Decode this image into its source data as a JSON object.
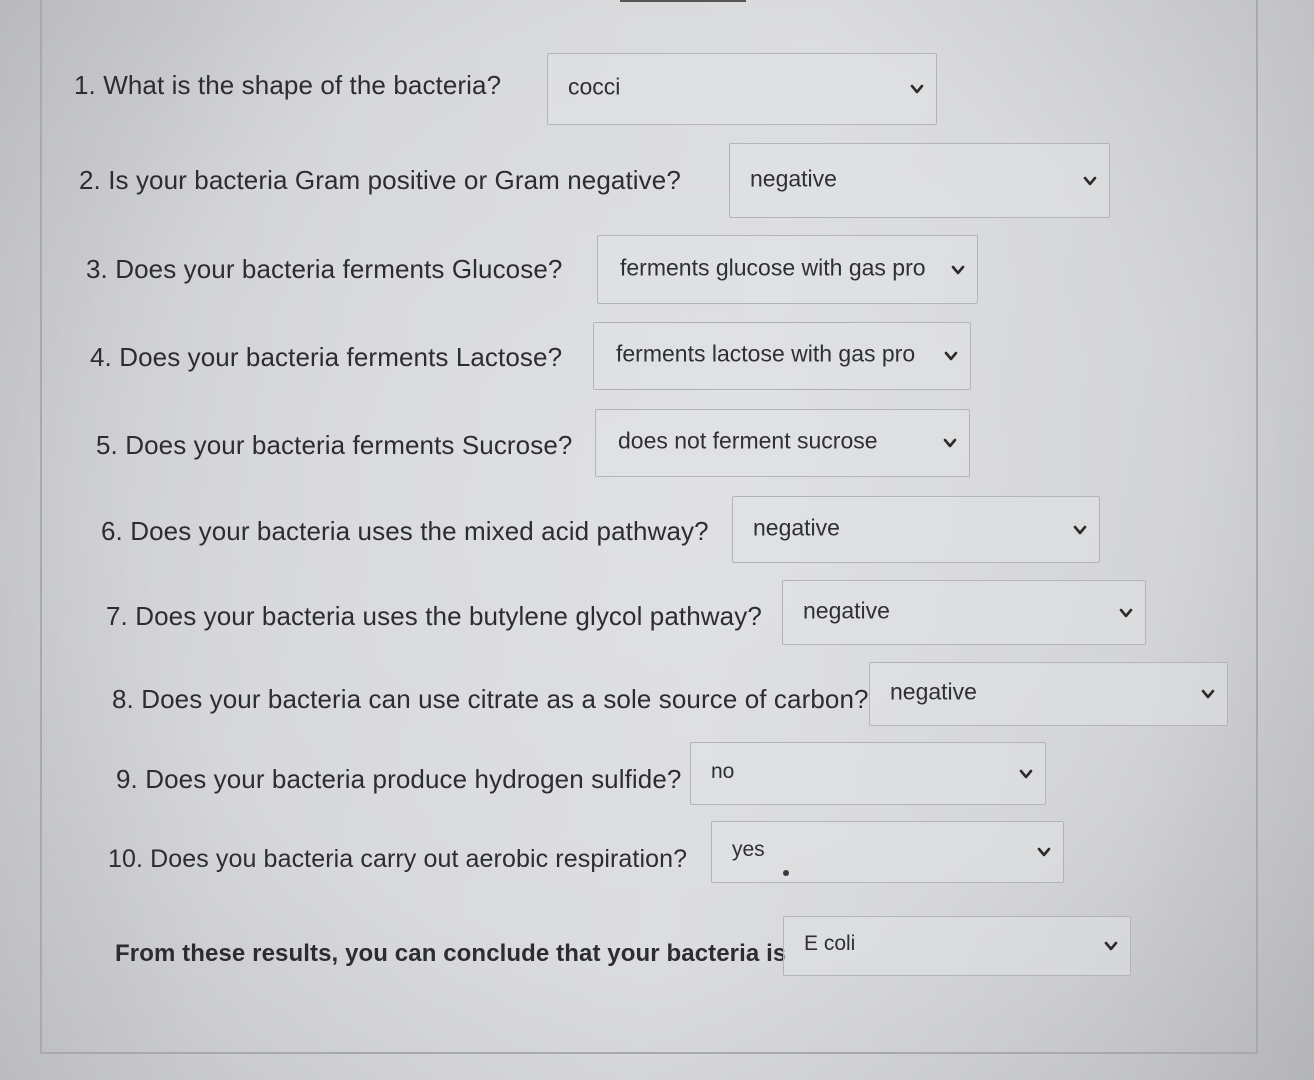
{
  "questions": [
    {
      "text": "1. What is the shape of the bacteria?",
      "answer": "cocci"
    },
    {
      "text": "2. Is your bacteria Gram positive or Gram negative?",
      "answer": "negative"
    },
    {
      "text": "3. Does your bacteria ferments Glucose?",
      "answer": "ferments glucose with gas pro"
    },
    {
      "text": "4. Does your bacteria ferments Lactose?",
      "answer": "ferments lactose with gas pro"
    },
    {
      "text": "5. Does your bacteria ferments Sucrose?",
      "answer": "does not ferment sucrose"
    },
    {
      "text": "6. Does your bacteria uses the mixed acid pathway?",
      "answer": "negative"
    },
    {
      "text": "7. Does your bacteria uses the butylene glycol pathway?",
      "answer": "negative"
    },
    {
      "text": "8. Does your bacteria can use citrate as a sole source of carbon?",
      "answer": "negative"
    },
    {
      "text": "9. Does your bacteria produce hydrogen sulfide?",
      "answer": "no"
    },
    {
      "text": "10. Does you bacteria carry out aerobic respiration?",
      "answer": "yes"
    }
  ],
  "conclusion": {
    "text": "From these results, you can conclude that your bacteria is",
    "answer": "E coli"
  },
  "icons": {
    "dropdown": "chevron-down-icon"
  }
}
